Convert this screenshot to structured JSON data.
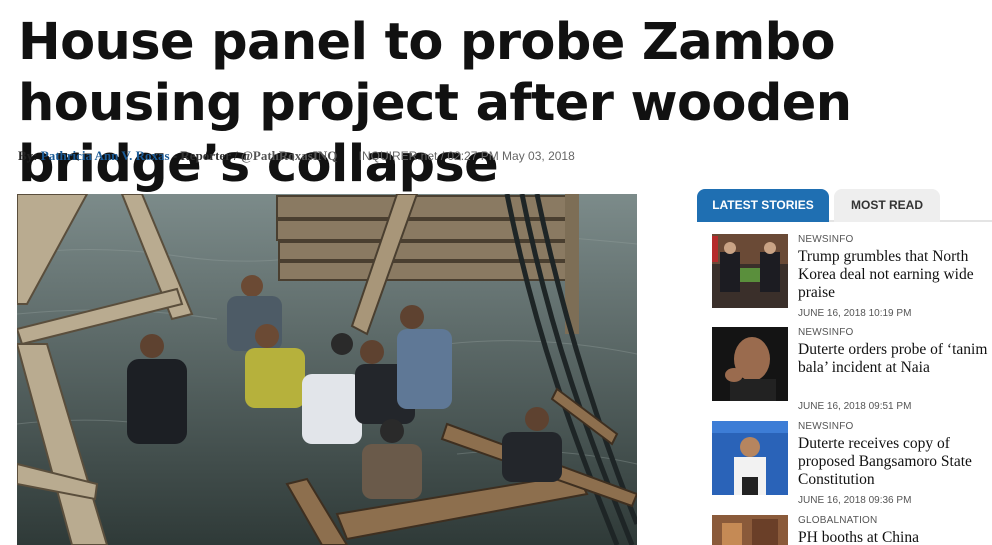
{
  "article": {
    "headline": "House panel to probe Zambo housing project after wooden bridge’s collapse",
    "by_label": "By:",
    "author": "Pathricia Ann V. Roxas",
    "role": "- Reporter /",
    "handle": "@PathRoxasINQ",
    "source_meta": "INQUIRER.net / 02:27 PM May 03, 2018"
  },
  "sidebar": {
    "tabs": [
      {
        "label": "LATEST STORIES",
        "active": true
      },
      {
        "label": "MOST READ",
        "active": false
      }
    ],
    "stories": [
      {
        "category": "NEWSINFO",
        "title": "Trump grumbles that North Korea deal not earning wide praise",
        "date": "JUNE 16, 2018 10:19 PM"
      },
      {
        "category": "NEWSINFO",
        "title": "Duterte orders probe of ‘tanim bala’ incident at Naia",
        "date": "JUNE 16, 2018 09:51 PM"
      },
      {
        "category": "NEWSINFO",
        "title": "Duterte receives copy of proposed Bangsamoro State Constitution",
        "date": "JUNE 16, 2018 09:36 PM"
      },
      {
        "category": "GLOBALNATION",
        "title": "PH booths at China",
        "date": ""
      }
    ]
  },
  "colors": {
    "accent": "#1f6fb2",
    "author_link": "#1a5a96"
  }
}
